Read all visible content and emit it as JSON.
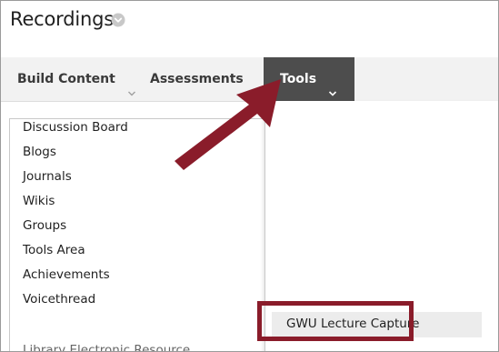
{
  "header": {
    "title": "Recordings",
    "title_icon": "chevron-down-circle-icon"
  },
  "menu": {
    "items": [
      {
        "label": "Build Content",
        "icon": "chevron-down-icon"
      },
      {
        "label": "Assessments",
        "icon": "chevron-down-icon"
      },
      {
        "label": "Tools",
        "icon": "chevron-down-icon",
        "active": true
      }
    ]
  },
  "tools_menu": {
    "items": [
      {
        "label": "Discussion Board"
      },
      {
        "label": "Blogs"
      },
      {
        "label": "Journals"
      },
      {
        "label": "Wikis"
      },
      {
        "label": "Groups"
      },
      {
        "label": "Tools Area"
      },
      {
        "label": "Achievements"
      },
      {
        "label": "Voicethread"
      },
      {
        "label": "GWU Lecture Capture",
        "highlighted": true
      },
      {
        "label": "Library Electronic Resource"
      }
    ]
  },
  "annotation": {
    "color": "#8a1c2a",
    "arrow_icon": "arrow-icon"
  },
  "colors": {
    "menu_bar": "#f2f2f2",
    "active_tab": "#4d4d4d",
    "highlight": "#8a1c2a"
  }
}
